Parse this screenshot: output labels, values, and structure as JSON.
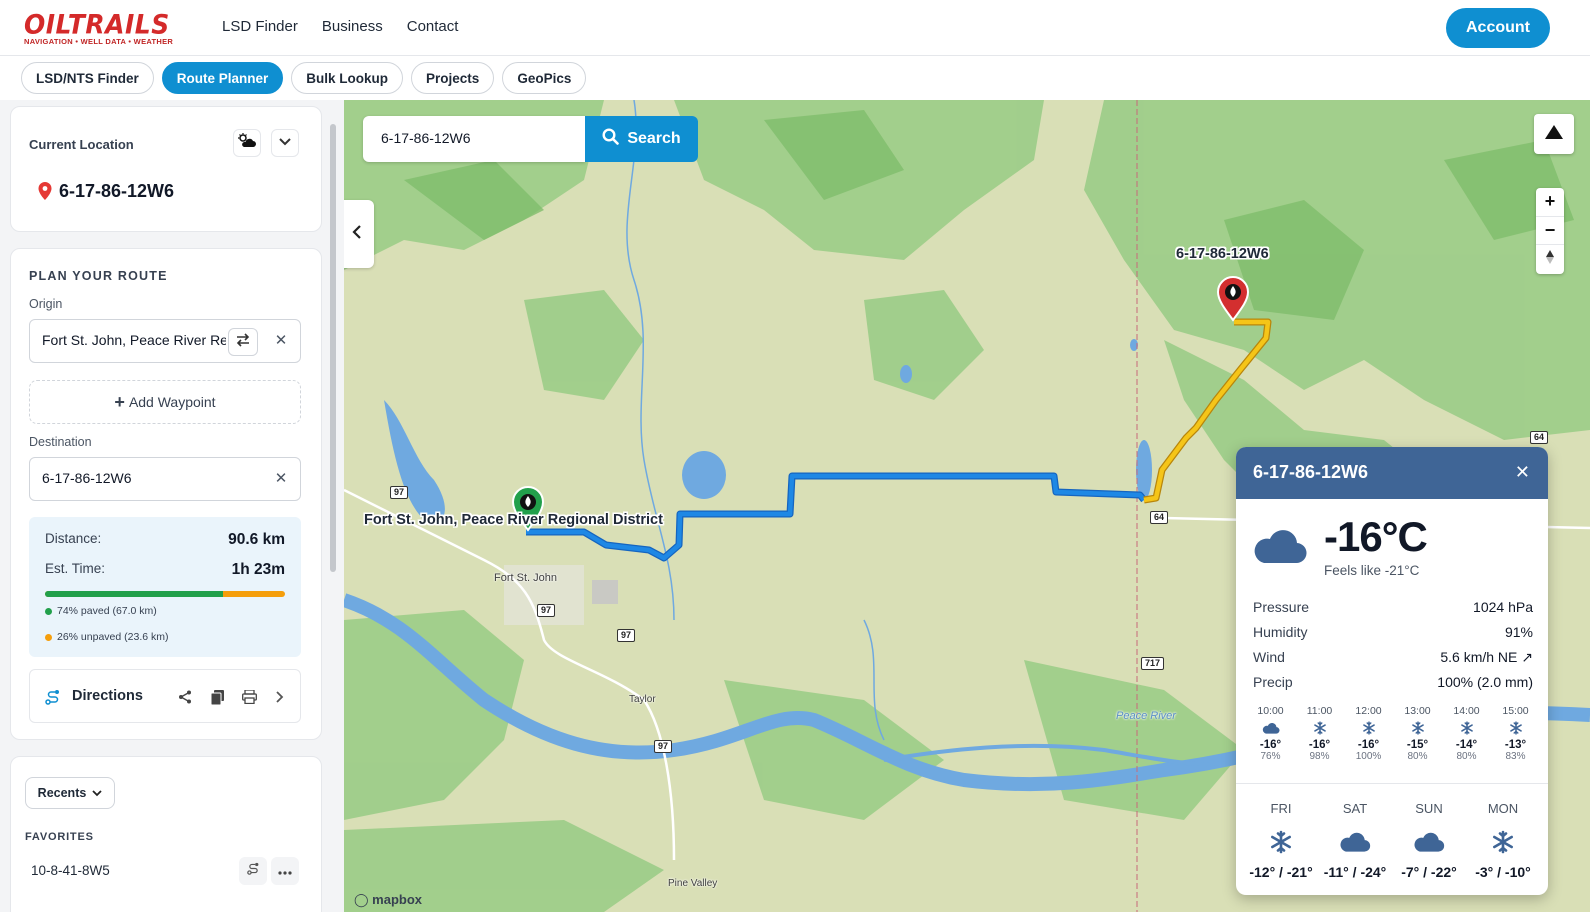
{
  "header": {
    "logo_main": "OILTRAILS",
    "logo_sub": "NAVIGATION • WELL DATA • WEATHER",
    "nav": [
      "LSD Finder",
      "Business",
      "Contact"
    ],
    "account_label": "Account",
    "accent_color": "#0f8fd1"
  },
  "tabs": [
    {
      "label": "LSD/NTS Finder",
      "active": false
    },
    {
      "label": "Route Planner",
      "active": true
    },
    {
      "label": "Bulk Lookup",
      "active": false
    },
    {
      "label": "Projects",
      "active": false
    },
    {
      "label": "GeoPics",
      "active": false
    }
  ],
  "sidebar": {
    "current_location": {
      "label": "Current Location",
      "value": "6-17-86-12W6",
      "icons": [
        "weather-icon",
        "chevron-down-icon",
        "map-pin-icon"
      ]
    },
    "route": {
      "title": "PLAN YOUR ROUTE",
      "origin_label": "Origin",
      "origin_value": "Fort St. John, Peace River Regional District",
      "add_waypoint": "Add Waypoint",
      "destination_label": "Destination",
      "destination_value": "6-17-86-12W6",
      "distance_label": "Distance:",
      "distance_value": "90.6 km",
      "time_label": "Est. Time:",
      "time_value": "1h 23m",
      "paved_fraction": 0.74,
      "paved_text": "74% paved (67.0 km)",
      "unpaved_text": "26% unpaved (23.6 km)",
      "paved_color": "#22a04b",
      "unpaved_color": "#f59e0b",
      "directions_label": "Directions"
    },
    "recents_label": "Recents",
    "favorites_title": "FAVORITES",
    "favorites": [
      "10-8-41-8W5"
    ]
  },
  "map": {
    "search_value": "6-17-86-12W6",
    "search_button": "Search",
    "origin_marker_label": "Fort St. John, Peace River Regional District",
    "destination_marker_label": "6-17-86-12W6",
    "towns": [
      "Fort St. John",
      "Taylor",
      "Pine Valley",
      "Peace River"
    ],
    "highways": [
      "97",
      "97",
      "97",
      "97",
      "64",
      "64",
      "717"
    ],
    "attribution": "mapbox",
    "route_paved_color": "#1e88e5",
    "route_unpaved_color": "#f5c518"
  },
  "weather": {
    "title": "6-17-86-12W6",
    "temp": "-16°C",
    "feels_like": "Feels like -21°C",
    "rows": [
      {
        "label": "Pressure",
        "value": "1024 hPa"
      },
      {
        "label": "Humidity",
        "value": "91%"
      },
      {
        "label": "Wind",
        "value": "5.6 km/h NE ↗"
      },
      {
        "label": "Precip",
        "value": "100% (2.0 mm)"
      }
    ],
    "hourly": [
      {
        "time": "10:00",
        "icon": "cloud-icon",
        "temp": "-16°",
        "humidity": "76%"
      },
      {
        "time": "11:00",
        "icon": "snowflake-icon",
        "temp": "-16°",
        "humidity": "98%"
      },
      {
        "time": "12:00",
        "icon": "snowflake-icon",
        "temp": "-16°",
        "humidity": "100%"
      },
      {
        "time": "13:00",
        "icon": "snowflake-icon",
        "temp": "-15°",
        "humidity": "80%"
      },
      {
        "time": "14:00",
        "icon": "snowflake-icon",
        "temp": "-14°",
        "humidity": "80%"
      },
      {
        "time": "15:00",
        "icon": "snowflake-icon",
        "temp": "-13°",
        "humidity": "83%"
      }
    ],
    "daily": [
      {
        "day": "FRI",
        "icon": "snowflake-icon",
        "range": "-12° / -21°"
      },
      {
        "day": "SAT",
        "icon": "cloud-icon",
        "range": "-11° / -24°"
      },
      {
        "day": "SUN",
        "icon": "cloud-icon",
        "range": "-7° / -22°"
      },
      {
        "day": "MON",
        "icon": "snowflake-icon",
        "range": "-3° / -10°"
      }
    ],
    "header_color": "#3f6596",
    "icon_color": "#3f6596"
  }
}
